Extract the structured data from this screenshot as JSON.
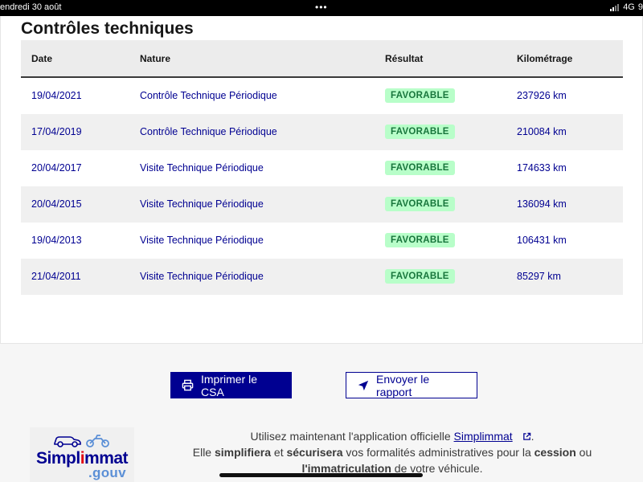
{
  "statusbar": {
    "time": "endredi 30 août",
    "dots": "•••",
    "network": "4G",
    "extra": "9"
  },
  "section": {
    "title": "Contrôles techniques"
  },
  "table": {
    "headers": {
      "date": "Date",
      "nature": "Nature",
      "result": "Résultat",
      "mileage": "Kilométrage"
    },
    "rows": [
      {
        "date": "19/04/2021",
        "nature": "Contrôle Technique Périodique",
        "result": "FAVORABLE",
        "mileage": "237926 km"
      },
      {
        "date": "17/04/2019",
        "nature": "Contrôle Technique Périodique",
        "result": "FAVORABLE",
        "mileage": "210084 km"
      },
      {
        "date": "20/04/2017",
        "nature": "Visite Technique Périodique",
        "result": "FAVORABLE",
        "mileage": "174633 km"
      },
      {
        "date": "20/04/2015",
        "nature": "Visite Technique Périodique",
        "result": "FAVORABLE",
        "mileage": "136094 km"
      },
      {
        "date": "19/04/2013",
        "nature": "Visite Technique Périodique",
        "result": "FAVORABLE",
        "mileage": "106431 km"
      },
      {
        "date": "21/04/2011",
        "nature": "Visite Technique Périodique",
        "result": "FAVORABLE",
        "mileage": "85297 km"
      }
    ]
  },
  "actions": {
    "print_label": "Imprimer le CSA",
    "send_label": "Envoyer le rapport"
  },
  "logo": {
    "brand_a": "Simpl",
    "brand_b": "i",
    "brand_c": "mmat",
    "suffix": ".gouv"
  },
  "promo": {
    "line1_before": "Utilisez maintenant l'application officielle ",
    "link": "Simplimmat",
    "line1_after": ".",
    "line2_a": "Elle ",
    "line2_b": "simplifiera",
    "line2_c": " et ",
    "line2_d": "sécurisera",
    "line2_e": " vos formalités administratives pour la ",
    "line2_f": "cession",
    "line2_g": " ou",
    "line3_a": "l'immatriculation",
    "line3_b": " de votre véhicule."
  },
  "colors": {
    "primary": "#000091",
    "success_bg": "#b8fec9",
    "success_text": "#18753c",
    "brand_red": "#e1000f"
  }
}
